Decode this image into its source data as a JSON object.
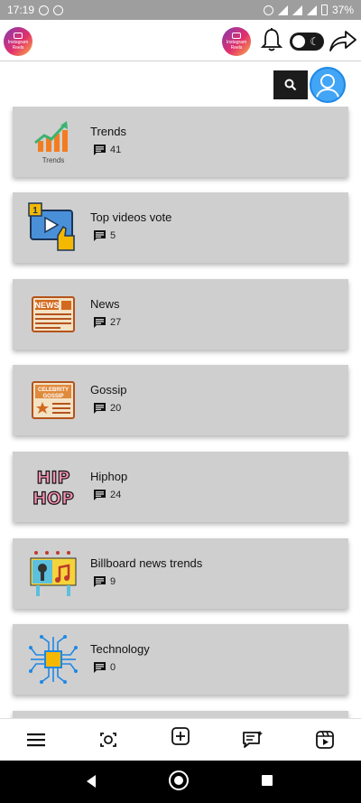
{
  "status_bar": {
    "time": "17:19",
    "battery": "37%"
  },
  "app_bar": {
    "logo_text": "Instagram Reels",
    "icons": [
      "instagram-reels-logo",
      "bell-icon",
      "dark-mode-toggle",
      "share-icon"
    ]
  },
  "search": {
    "icon": "search-icon"
  },
  "categories": [
    {
      "title": "Trends",
      "count": "41",
      "thumb_label": "Trends"
    },
    {
      "title": "Top videos vote",
      "count": "5",
      "thumb_label": "1"
    },
    {
      "title": "News",
      "count": "27",
      "thumb_label": "NEWS"
    },
    {
      "title": "Gossip",
      "count": "20",
      "thumb_label_1": "CELEBRITY",
      "thumb_label_2": "GOSSIP"
    },
    {
      "title": "Hiphop",
      "count": "24",
      "thumb_label_1": "HIP",
      "thumb_label_2": "HOP"
    },
    {
      "title": "Billboard news trends",
      "count": "9"
    },
    {
      "title": "Technology",
      "count": "0"
    }
  ],
  "bottom_nav": [
    "menu-icon",
    "camera-icon",
    "add-post-icon",
    "chat-icon",
    "reels-icon"
  ],
  "colors": {
    "card_bg": "#cfcfcf",
    "avatar": "#42a5f5",
    "dark": "#1c1c1c"
  }
}
